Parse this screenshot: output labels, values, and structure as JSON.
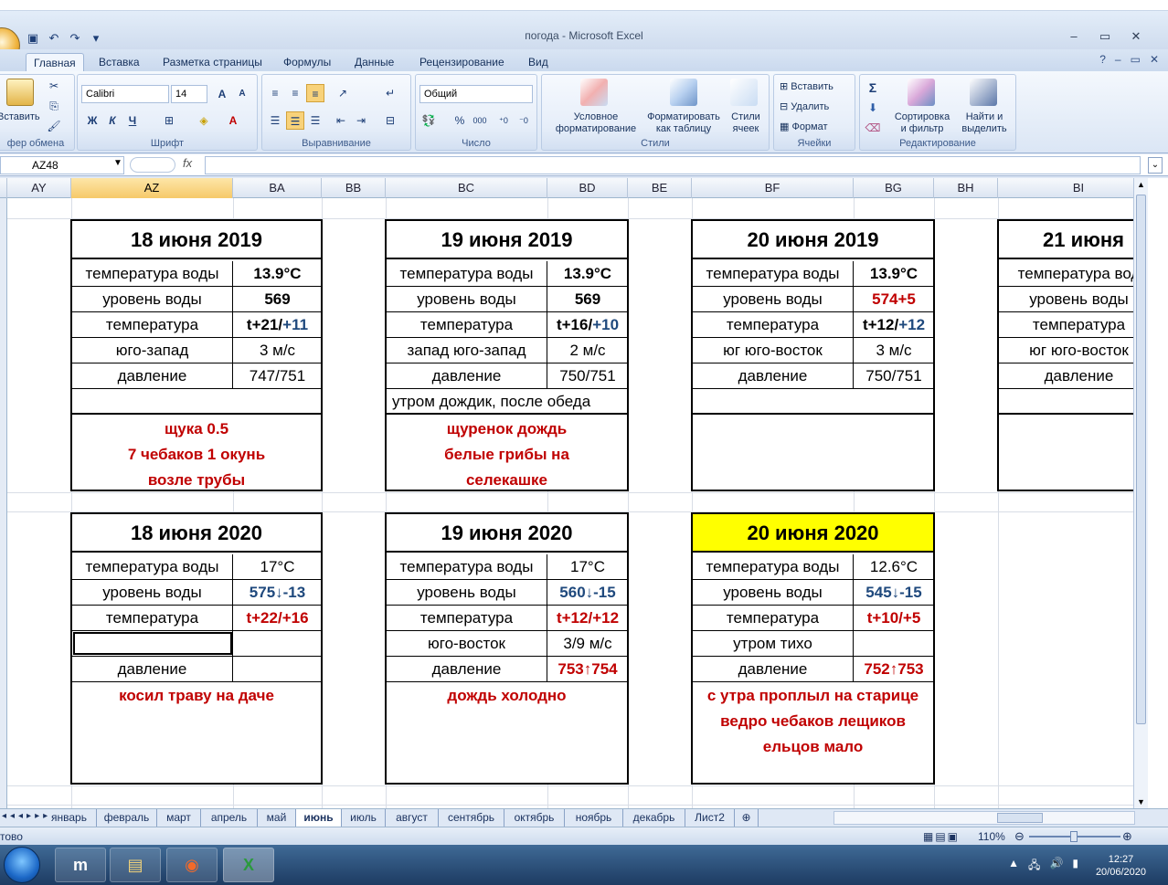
{
  "window": {
    "title": "погода - Microsoft Excel"
  },
  "tabs": [
    "Главная",
    "Вставка",
    "Разметка страницы",
    "Формулы",
    "Данные",
    "Рецензирование",
    "Вид"
  ],
  "ribbon": {
    "clipboard": {
      "paste": "Вставить",
      "label": "фер обмена"
    },
    "font": {
      "name": "Calibri",
      "size": "14",
      "label": "Шрифт",
      "bold": "Ж",
      "italic": "К",
      "underline": "Ч"
    },
    "alignment": {
      "label": "Выравнивание"
    },
    "number": {
      "format": "Общий",
      "label": "Число",
      "percent": "%",
      "thousands": "000"
    },
    "styles": {
      "conditional": [
        "Условное",
        "форматирование"
      ],
      "table": [
        "Форматировать",
        "как таблицу"
      ],
      "cell": [
        "Стили",
        "ячеек"
      ],
      "label": "Стили"
    },
    "cells": {
      "insert": "Вставить",
      "delete": "Удалить",
      "format": "Формат",
      "label": "Ячейки"
    },
    "editing": {
      "sort": [
        "Сортировка",
        "и фильтр"
      ],
      "find": [
        "Найти и",
        "выделить"
      ],
      "label": "Редактирование",
      "sigma": "Σ"
    }
  },
  "formula_bar": {
    "name_box": "AZ48",
    "fx": "fx",
    "value": ""
  },
  "columns": [
    "AY",
    "AZ",
    "BA",
    "BB",
    "BC",
    "BD",
    "BE",
    "BF",
    "BG",
    "BH",
    "BI"
  ],
  "selected_column": "AZ",
  "cards_2019": [
    {
      "title": "18 июня 2019",
      "rows": [
        {
          "k": "температура воды",
          "v": "13.9°C",
          "style": "b"
        },
        {
          "k": "уровень воды",
          "v": "569",
          "style": "b"
        },
        {
          "k": "температура",
          "v1": "t+21/",
          "v2": "+11"
        },
        {
          "k": "юго-запад",
          "v": "3 м/с",
          "style": ""
        },
        {
          "k": "давление",
          "v": "747/751",
          "style": ""
        }
      ],
      "extra": "",
      "notes": [
        "щука 0.5",
        "7 чебаков 1 окунь",
        "возле трубы"
      ]
    },
    {
      "title": "19 июня 2019",
      "rows": [
        {
          "k": "температура воды",
          "v": "13.9°C",
          "style": "b"
        },
        {
          "k": "уровень воды",
          "v": "569",
          "style": "b"
        },
        {
          "k": "температура",
          "v1": "t+16/",
          "v2": "+10"
        },
        {
          "k": "запад юго-запад",
          "v": "2 м/с",
          "style": ""
        },
        {
          "k": "давление",
          "v": "750/751",
          "style": ""
        }
      ],
      "extra": "утром дождик, после обеда",
      "notes": [
        "щуренок дождь",
        "белые грибы на",
        "селекашке"
      ]
    },
    {
      "title": "20 июня 2019",
      "rows": [
        {
          "k": "температура воды",
          "v": "13.9°C",
          "style": "b"
        },
        {
          "k": "уровень воды",
          "v": "574+5",
          "style": "b red"
        },
        {
          "k": "температура",
          "v1": "t+12/",
          "v2": "+12"
        },
        {
          "k": "юг юго-восток",
          "v": "3 м/с",
          "style": ""
        },
        {
          "k": "давление",
          "v": "750/751",
          "style": ""
        }
      ],
      "extra": "",
      "notes": [
        "",
        "",
        ""
      ]
    },
    {
      "title": "21 июня",
      "rows": [
        {
          "k": "температура вод",
          "v": "",
          "style": ""
        },
        {
          "k": "уровень воды",
          "v": "",
          "style": ""
        },
        {
          "k": "температура",
          "v": "",
          "style": ""
        },
        {
          "k": "юг юго-восток",
          "v": "",
          "style": ""
        },
        {
          "k": "давление",
          "v": "",
          "style": ""
        }
      ],
      "extra": "",
      "notes": [
        "",
        "",
        ""
      ]
    }
  ],
  "cards_2020": [
    {
      "title": "18 июня 2020",
      "rows": [
        {
          "k": "температура воды",
          "v": "17°C",
          "style": ""
        },
        {
          "k": "уровень воды",
          "v": "575↓-13",
          "style": "b blue"
        },
        {
          "k": "температура",
          "v": "t+22/+16",
          "style": "b red"
        },
        {
          "k": "",
          "v": "",
          "style": ""
        },
        {
          "k": "давление",
          "v": "",
          "style": ""
        }
      ],
      "notes": [
        "косил траву на даче",
        "",
        ""
      ]
    },
    {
      "title": "19 июня 2020",
      "rows": [
        {
          "k": "температура воды",
          "v": "17°C",
          "style": ""
        },
        {
          "k": "уровень воды",
          "v": "560↓-15",
          "style": "b blue"
        },
        {
          "k": "температура",
          "v": "t+12/+12",
          "style": "b red"
        },
        {
          "k": "юго-восток",
          "v": "3/9 м/с",
          "style": ""
        },
        {
          "k": "давление",
          "v": "753↑754",
          "style": "b red"
        }
      ],
      "notes": [
        "дождь холодно",
        "",
        ""
      ]
    },
    {
      "title": "20 июня 2020",
      "highlight": true,
      "rows": [
        {
          "k": "температура воды",
          "v": "12.6°C",
          "style": ""
        },
        {
          "k": "уровень воды",
          "v": "545↓-15",
          "style": "b blue"
        },
        {
          "k": "температура",
          "v": "t+10/+5",
          "style": "b red"
        },
        {
          "k": "утром тихо",
          "v": "",
          "style": ""
        },
        {
          "k": "давление",
          "v": "752↑753",
          "style": "b red"
        }
      ],
      "notes": [
        "с утра проплыл на старице",
        "ведро чебаков лещиков",
        "ельцов мало"
      ]
    }
  ],
  "sheet_tabs": [
    "январь",
    "февраль",
    "март",
    "апрель",
    "май",
    "июнь",
    "июль",
    "август",
    "сентябрь",
    "октябрь",
    "ноябрь",
    "декабрь",
    "Лист2"
  ],
  "active_sheet": "июнь",
  "status": {
    "left": "тово",
    "zoom": "110%"
  },
  "taskbar": {
    "time": "12:27",
    "date": "20/06/2020"
  },
  "colors": {
    "highlight": "#ffff00",
    "red": "#c00000",
    "blue": "#1f497d",
    "selected_header": "#f6c969"
  }
}
